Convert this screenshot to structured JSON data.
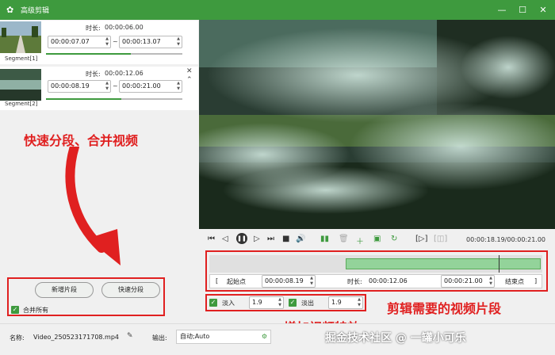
{
  "window": {
    "title": "高级剪辑"
  },
  "segments": [
    {
      "label": "Segment[1]",
      "duration_label": "时长:",
      "duration": "00:00:06.00",
      "start": "00:00:07.07",
      "end": "00:00:13.07",
      "dash": "~",
      "progress": 0.62
    },
    {
      "label": "Segment[2]",
      "duration_label": "时长:",
      "duration": "00:00:12.06",
      "start": "00:00:08.19",
      "end": "00:00:21.00",
      "dash": "~",
      "progress": 0.55
    }
  ],
  "annotations": {
    "left": "快速分段、合并视频",
    "right": "剪辑需要的视频片段",
    "bottom": "增加视频特效"
  },
  "left_actions": {
    "add_segment": "新增片段",
    "quick_split": "快速分段",
    "merge_all": "合并所有"
  },
  "player": {
    "time": "00:00:18.19/00:00:21.00"
  },
  "timeline": {
    "selection_start": 0.41,
    "selection_end": 1.0,
    "playhead": 0.87,
    "start_bracket": "[",
    "start_label": "起始点",
    "start_value": "00:00:08.19",
    "duration_label": "时长:",
    "duration_value": "00:00:12.06",
    "end_value": "00:00:21.00",
    "end_label": "结束点",
    "end_bracket": "]"
  },
  "effects": {
    "fade_in_label": "淡入",
    "fade_in_value": "1.9",
    "fade_out_label": "淡出",
    "fade_out_value": "1.9"
  },
  "bottom": {
    "name_label": "名称:",
    "name_value": "Video_250523171708.mp4",
    "output_label": "输出:",
    "output_value": "自动;Auto"
  },
  "watermark": "掘金技术社区 @ 一罐小可乐"
}
